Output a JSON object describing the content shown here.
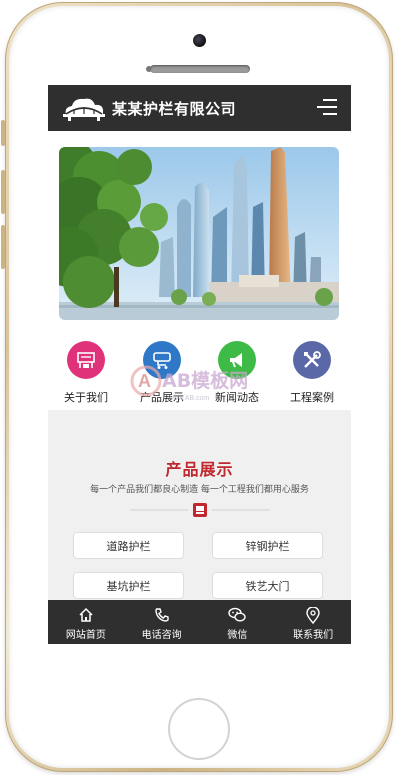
{
  "header": {
    "company_name": "某某护栏有限公司",
    "logo_icon": "bridge-cloud-logo",
    "menu_icon": "hamburger-menu-icon"
  },
  "banner": {
    "image": "city-skyline-with-trees"
  },
  "quick_nav": [
    {
      "label": "关于我们",
      "icon": "company-building-icon",
      "color": "#e0327a"
    },
    {
      "label": "产品展示",
      "icon": "product-cart-icon",
      "color": "#2f78c8"
    },
    {
      "label": "新闻动态",
      "icon": "megaphone-icon",
      "color": "#3dbb46"
    },
    {
      "label": "工程案例",
      "icon": "tools-icon",
      "color": "#5a68a8"
    }
  ],
  "watermark": {
    "text": "AB模板网",
    "subtext": "www.AB.com"
  },
  "products": {
    "title": "产品展示",
    "subtitle": "每一个产品我们都良心制造 每一个工程我们都用心服务",
    "items": [
      "道路护栏",
      "锌钢护栏",
      "基坑护栏",
      "铁艺大门"
    ]
  },
  "bottom_nav": [
    {
      "label": "网站首页",
      "icon": "home-icon"
    },
    {
      "label": "电话咨询",
      "icon": "phone-icon"
    },
    {
      "label": "微信",
      "icon": "wechat-icon"
    },
    {
      "label": "联系我们",
      "icon": "location-pin-icon"
    }
  ],
  "colors": {
    "accent": "#c0282d",
    "bar": "#2f2f2f",
    "section_bg": "#f0f0f0"
  }
}
